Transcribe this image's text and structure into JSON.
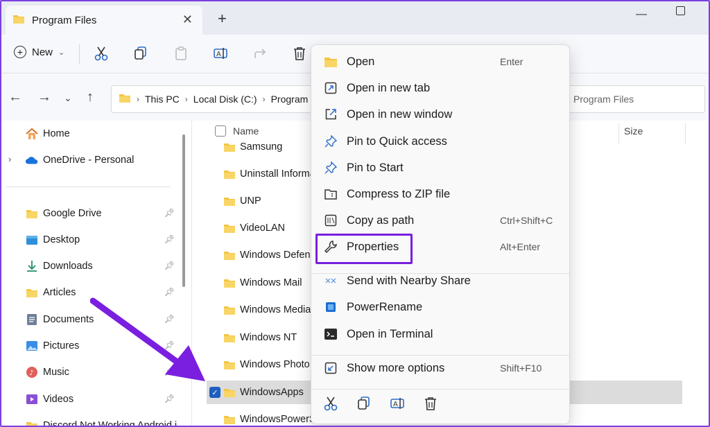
{
  "window": {
    "tab_title": "Program Files",
    "new_tab": "+",
    "minimize": "—"
  },
  "toolbar": {
    "new_label": "New"
  },
  "address": {
    "crumbs": [
      "This PC",
      "Local Disk (C:)",
      "Program"
    ],
    "search_placeholder": "Program Files"
  },
  "sidebar": {
    "home": "Home",
    "onedrive": "OneDrive - Personal",
    "pinned": [
      {
        "label": "Google Drive",
        "icon": "folder-icon"
      },
      {
        "label": "Desktop",
        "icon": "desktop-icon"
      },
      {
        "label": "Downloads",
        "icon": "download-icon"
      },
      {
        "label": "Articles",
        "icon": "folder-icon"
      },
      {
        "label": "Documents",
        "icon": "documents-icon"
      },
      {
        "label": "Pictures",
        "icon": "pictures-icon"
      },
      {
        "label": "Music",
        "icon": "music-icon"
      },
      {
        "label": "Videos",
        "icon": "videos-icon"
      },
      {
        "label": "Discord Not Working Android i",
        "icon": "folder-icon"
      }
    ]
  },
  "content": {
    "columns": {
      "name": "Name",
      "size": "Size"
    },
    "files": [
      "Samsung",
      "Uninstall Informa",
      "UNP",
      "VideoLAN",
      "Windows Defenc",
      "Windows Mail",
      "Windows Media",
      "Windows NT",
      "Windows Photo",
      "WindowsApps",
      "WindowsPowerSh"
    ],
    "selected_file": "WindowsApps"
  },
  "context_menu": {
    "items": [
      {
        "label": "Open",
        "shortcut": "Enter",
        "icon": "folder-open-icon"
      },
      {
        "label": "Open in new tab",
        "shortcut": "",
        "icon": "new-tab-icon"
      },
      {
        "label": "Open in new window",
        "shortcut": "",
        "icon": "new-window-icon"
      },
      {
        "label": "Pin to Quick access",
        "shortcut": "",
        "icon": "pin-icon"
      },
      {
        "label": "Pin to Start",
        "shortcut": "",
        "icon": "pin-icon"
      },
      {
        "label": "Compress to ZIP file",
        "shortcut": "",
        "icon": "zip-icon"
      },
      {
        "label": "Copy as path",
        "shortcut": "Ctrl+Shift+C",
        "icon": "copy-path-icon"
      },
      {
        "label": "Properties",
        "shortcut": "Alt+Enter",
        "icon": "wrench-icon"
      },
      {
        "label": "Send with Nearby Share",
        "shortcut": "",
        "icon": "nearby-share-icon"
      },
      {
        "label": "PowerRename",
        "shortcut": "",
        "icon": "powerrename-icon"
      },
      {
        "label": "Open in Terminal",
        "shortcut": "",
        "icon": "terminal-icon"
      },
      {
        "label": "Show more options",
        "shortcut": "Shift+F10",
        "icon": "more-options-icon"
      }
    ],
    "highlighted": "Properties"
  },
  "colors": {
    "accent": "#7a1fe0",
    "folder": "#f4c542",
    "selection": "#dcdcdc",
    "check": "#1f5fbf"
  }
}
